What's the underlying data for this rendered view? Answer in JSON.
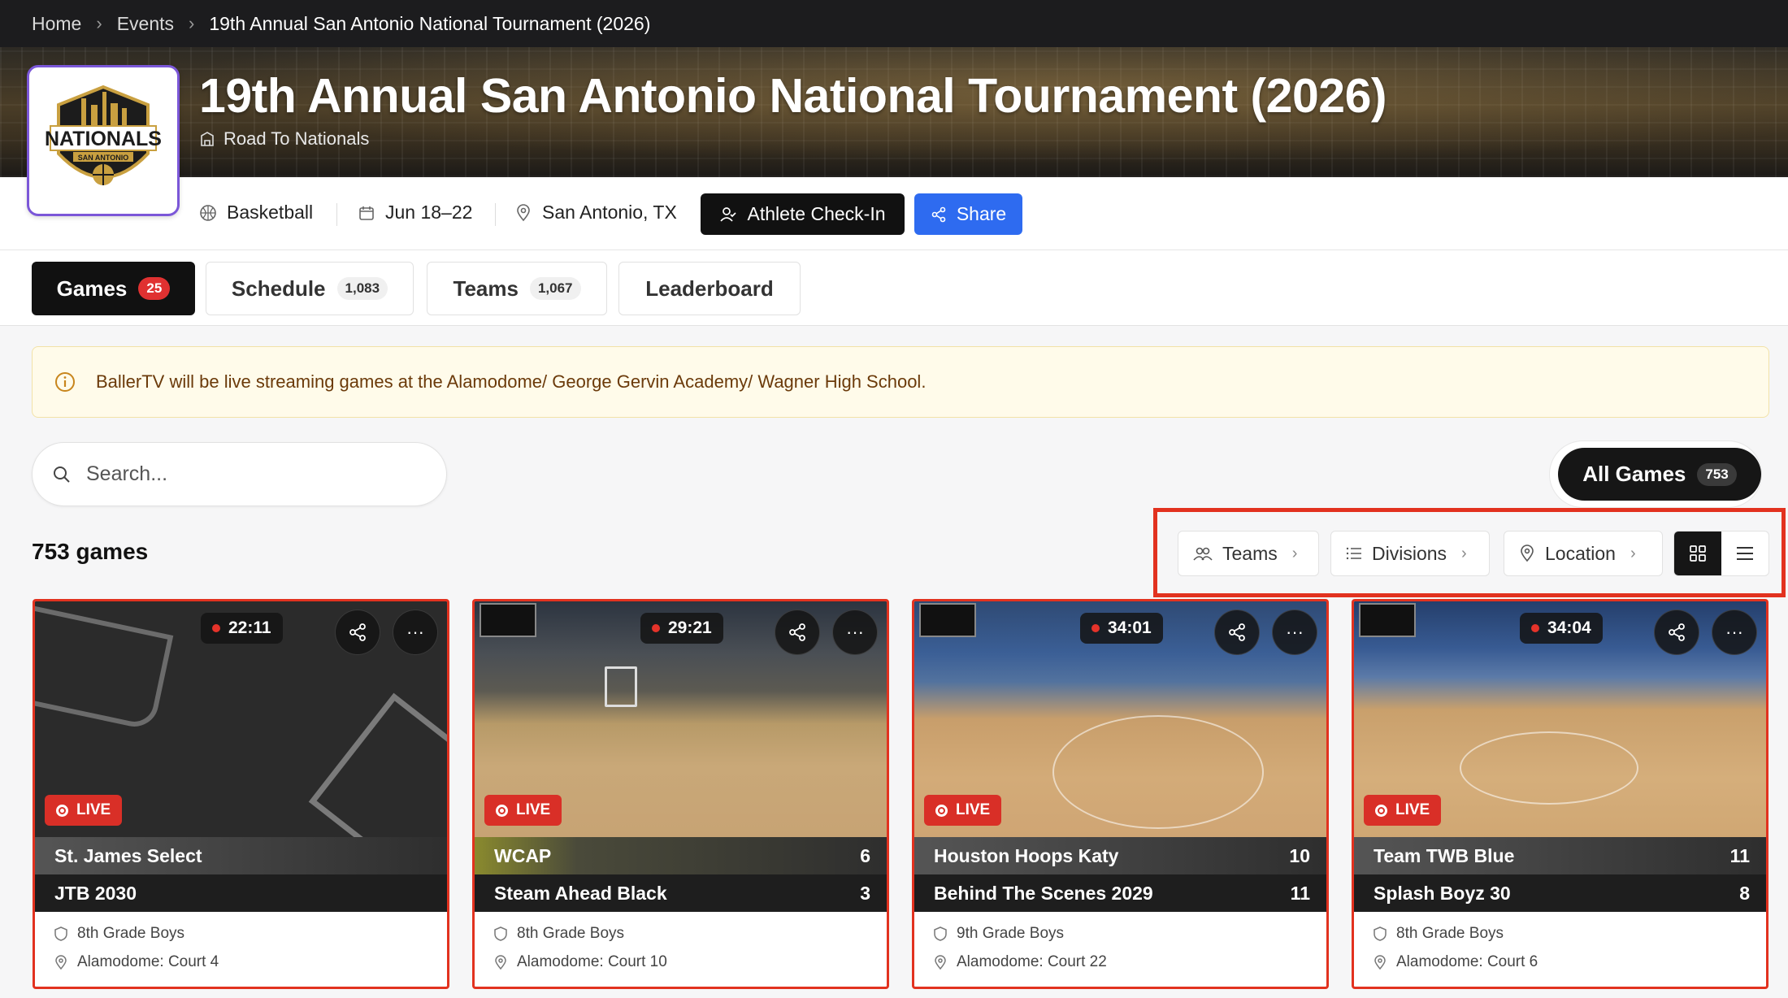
{
  "breadcrumb": {
    "home": "Home",
    "events": "Events",
    "current": "19th Annual San Antonio National Tournament (2026)"
  },
  "event": {
    "title": "19th Annual San Antonio National Tournament (2026)",
    "organizer": "Road To Nationals",
    "logo_text": "NATIONALS",
    "logo_subtext": "SAN ANTONIO",
    "sport": "Basketball",
    "dates": "Jun 18–22",
    "location": "San Antonio, TX",
    "checkin_label": "Athlete Check-In",
    "share_label": "Share"
  },
  "tabs": [
    {
      "label": "Games",
      "count": "25"
    },
    {
      "label": "Schedule",
      "count": "1,083"
    },
    {
      "label": "Teams",
      "count": "1,067"
    },
    {
      "label": "Leaderboard"
    }
  ],
  "notice": "BallerTV will be live streaming games at the Alamodome/ George Gervin Academy/ Wagner High School.",
  "search": {
    "placeholder": "Search..."
  },
  "all_games": {
    "label": "All Games",
    "count": "753"
  },
  "games_count": "753 games",
  "filters": {
    "teams": "Teams",
    "divisions": "Divisions",
    "location": "Location"
  },
  "games": [
    {
      "time": "22:11",
      "live": "LIVE",
      "team1": "St. James Select",
      "score1": "",
      "team2": "JTB 2030",
      "score2": "",
      "division": "8th Grade Boys",
      "court": "Alamodome: Court 4"
    },
    {
      "time": "29:21",
      "live": "LIVE",
      "team1": "WCAP",
      "score1": "6",
      "team2": "Steam Ahead Black",
      "score2": "3",
      "division": "8th Grade Boys",
      "court": "Alamodome: Court 10"
    },
    {
      "time": "34:01",
      "live": "LIVE",
      "team1": "Houston Hoops Katy",
      "score1": "10",
      "team2": "Behind The Scenes 2029",
      "score2": "11",
      "division": "9th Grade Boys",
      "court": "Alamodome: Court 22"
    },
    {
      "time": "34:04",
      "live": "LIVE",
      "team1": "Team TWB Blue",
      "score1": "11",
      "team2": "Splash Boyz 30",
      "score2": "8",
      "division": "8th Grade Boys",
      "court": "Alamodome: Court 6"
    }
  ],
  "colors": {
    "accent_blue": "#2e6bf0",
    "live_red": "#d92f27",
    "highlight_box": "#e2321f",
    "active_tab": "#111111"
  }
}
